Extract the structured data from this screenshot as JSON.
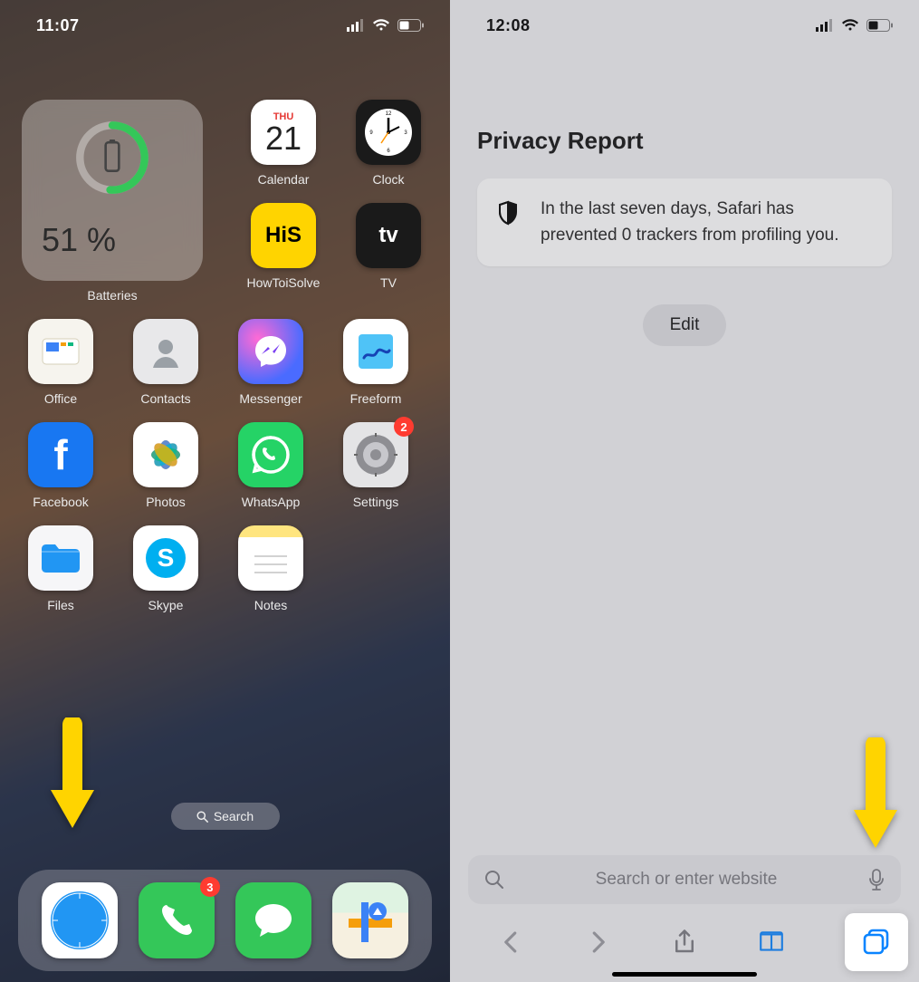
{
  "left": {
    "status_time": "11:07",
    "battery_widget": {
      "percent": "51 %",
      "label": "Batteries"
    },
    "apps": {
      "calendar": {
        "dow": "THU",
        "dom": "21",
        "label": "Calendar"
      },
      "clock": {
        "label": "Clock"
      },
      "his": {
        "text": "HiS",
        "label": "HowToiSolve"
      },
      "tv": {
        "glyph": "tv",
        "label": "TV"
      },
      "office": {
        "label": "Office"
      },
      "contacts": {
        "label": "Contacts"
      },
      "messenger": {
        "label": "Messenger"
      },
      "freeform": {
        "label": "Freeform"
      },
      "facebook": {
        "glyph": "f",
        "label": "Facebook"
      },
      "photos": {
        "label": "Photos"
      },
      "whatsapp": {
        "label": "WhatsApp"
      },
      "settings": {
        "label": "Settings",
        "badge": "2"
      },
      "files": {
        "label": "Files"
      },
      "skype": {
        "glyph": "S",
        "label": "Skype"
      },
      "notes": {
        "label": "Notes"
      }
    },
    "search_pill": "Search",
    "dock": {
      "safari": "Safari",
      "phone": {
        "label": "Phone",
        "badge": "3"
      },
      "messages": "Messages",
      "maps": "Maps"
    }
  },
  "right": {
    "status_time": "12:08",
    "privacy": {
      "title": "Privacy Report",
      "text": "In the last seven days, Safari has prevented 0 trackers from profiling you."
    },
    "edit": "Edit",
    "address_placeholder": "Search or enter website"
  },
  "colors": {
    "accent_yellow": "#ffd400",
    "badge_red": "#ff3b30",
    "ios_blue": "#0a84ff"
  }
}
